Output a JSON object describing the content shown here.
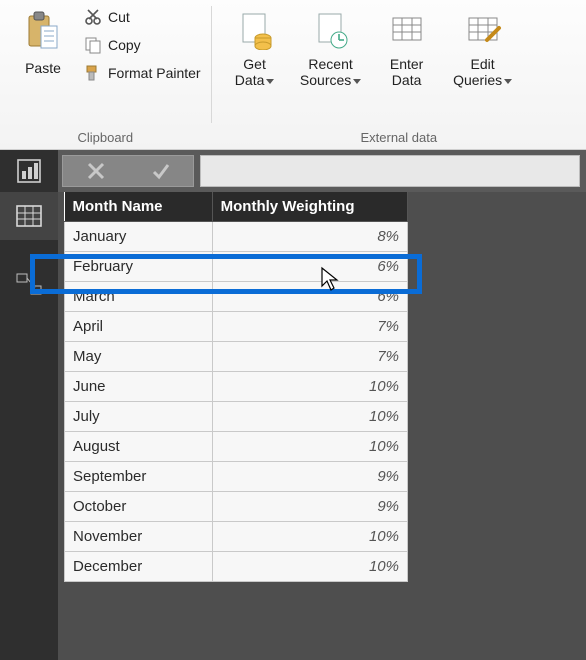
{
  "ribbon": {
    "clipboard": {
      "group_label": "Clipboard",
      "paste": "Paste",
      "cut": "Cut",
      "copy": "Copy",
      "format_painter": "Format Painter"
    },
    "external": {
      "group_label": "External data",
      "get_data": "Get\nData",
      "recent_sources": "Recent\nSources",
      "enter_data": "Enter\nData",
      "edit_queries": "Edit\nQueries"
    }
  },
  "table": {
    "headers": {
      "month": "Month Name",
      "weight": "Monthly Weighting"
    },
    "rows": [
      {
        "month": "January",
        "weight": "8%"
      },
      {
        "month": "February",
        "weight": "6%"
      },
      {
        "month": "March",
        "weight": "6%"
      },
      {
        "month": "April",
        "weight": "7%"
      },
      {
        "month": "May",
        "weight": "7%"
      },
      {
        "month": "June",
        "weight": "10%"
      },
      {
        "month": "July",
        "weight": "10%"
      },
      {
        "month": "August",
        "weight": "10%"
      },
      {
        "month": "September",
        "weight": "9%"
      },
      {
        "month": "October",
        "weight": "9%"
      },
      {
        "month": "November",
        "weight": "10%"
      },
      {
        "month": "December",
        "weight": "10%"
      }
    ]
  },
  "highlight_row_index": 1
}
